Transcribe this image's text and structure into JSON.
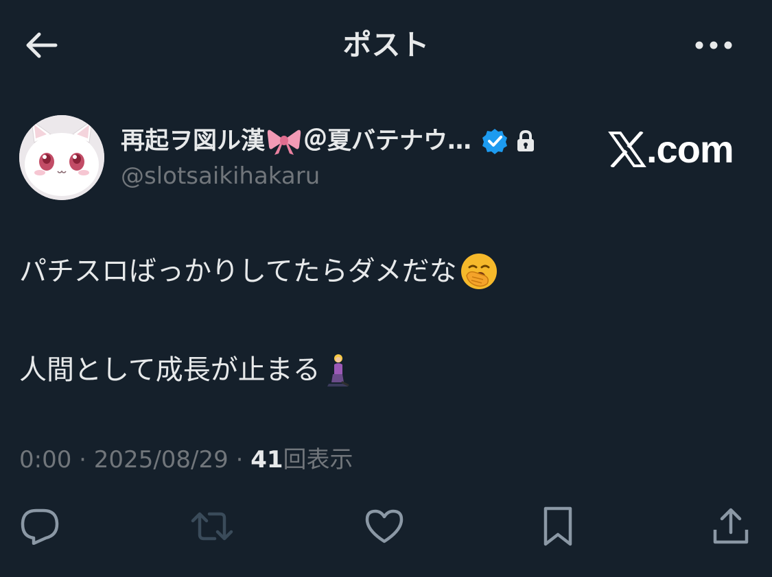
{
  "header": {
    "title": "ポスト",
    "back_icon": "arrow-left-icon",
    "more_icon": "more-horizontal-icon"
  },
  "author": {
    "display_name_part1": "再起ヲ図ル漢",
    "display_name_part2": "＠夏バテナウ…",
    "bow_emoji_icon": "ribbon-bow-icon",
    "handle": "@slotsaikihakaru",
    "verified_icon": "verified-badge-icon",
    "protected_icon": "lock-icon",
    "avatar_icon": "white-cat-avatar"
  },
  "watermark": {
    "x_symbol": "𝕏",
    "text": ".com"
  },
  "post": {
    "line1": "パチスロばっかりしてたらダメだな",
    "line1_emoji_icon": "yawning-face-icon",
    "line2": "人間として成長が止まる",
    "line2_emoji_icon": "kneeling-woman-icon"
  },
  "meta": {
    "time": "0:00",
    "separator": " · ",
    "date": "2025/08/29",
    "views_count": "41",
    "views_label": "回表示"
  },
  "actions": {
    "reply_icon": "reply-icon",
    "retweet_icon": "retweet-icon",
    "like_icon": "heart-icon",
    "bookmark_icon": "bookmark-icon",
    "share_icon": "share-icon"
  },
  "colors": {
    "background": "#15202b",
    "text_primary": "#e7e9ea",
    "text_secondary": "#71767b",
    "verified_blue": "#1d9bf0"
  }
}
